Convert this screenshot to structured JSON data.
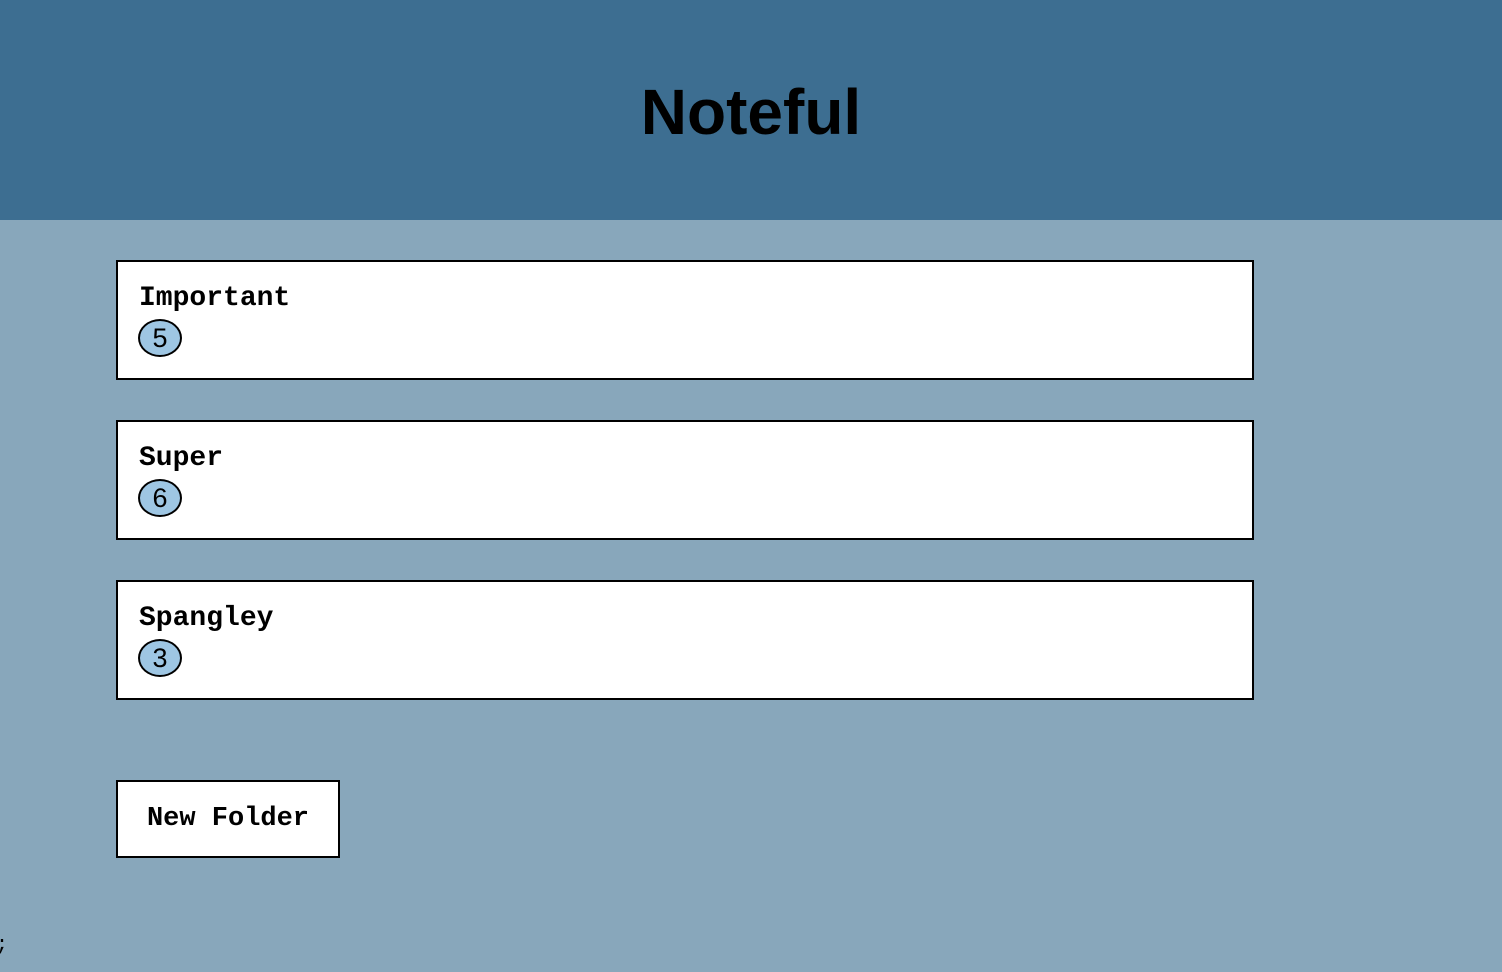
{
  "header": {
    "title": "Noteful"
  },
  "folders": [
    {
      "name": "Important",
      "note_count": "5"
    },
    {
      "name": "Super",
      "note_count": "6"
    },
    {
      "name": "Spangley",
      "note_count": "3"
    }
  ],
  "actions": {
    "new_folder_label": "New Folder"
  },
  "misc": {
    "corner_glyph": ";"
  },
  "colors": {
    "header_background": "#3d6e91",
    "page_background": "#88a7bb",
    "card_background": "#ffffff",
    "count_badge": "#9ec6e3"
  }
}
